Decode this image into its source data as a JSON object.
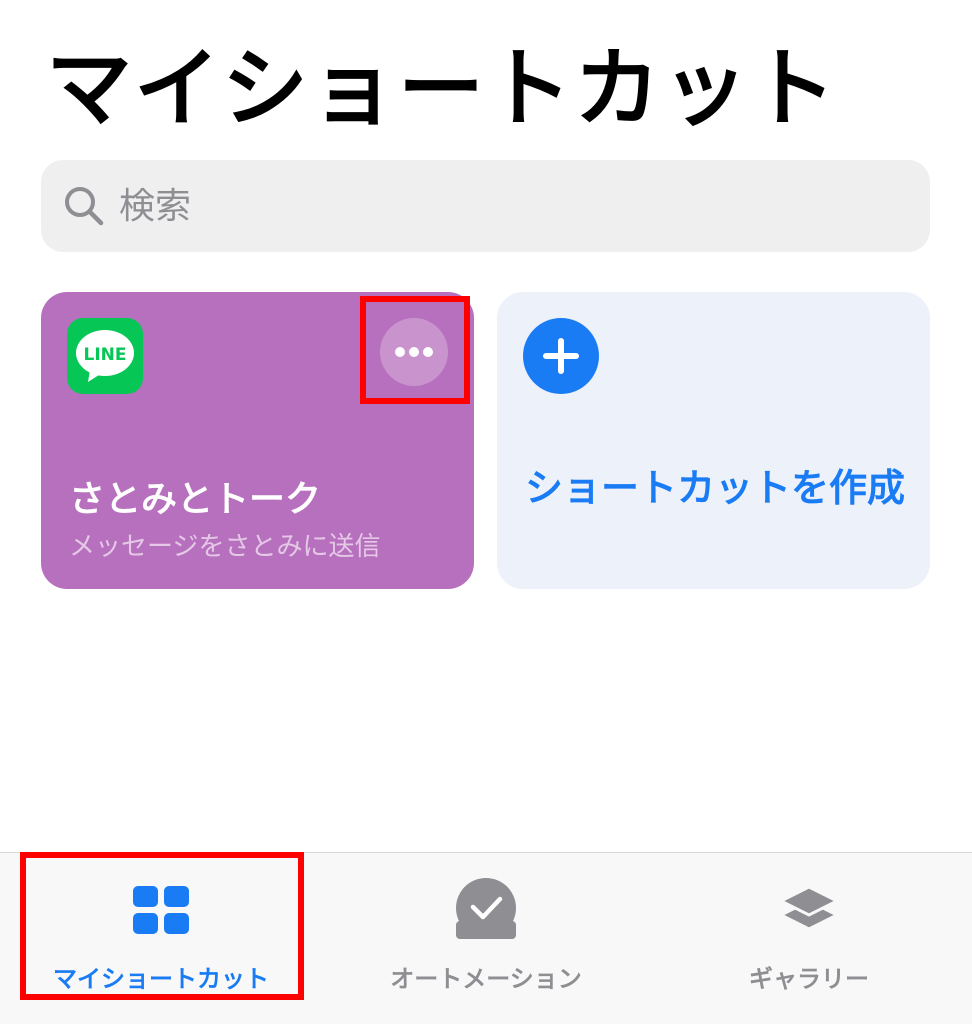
{
  "header": {
    "title": "マイショートカット"
  },
  "search": {
    "placeholder": "検索"
  },
  "shortcuts": [
    {
      "title": "さとみとトーク",
      "subtitle": "メッセージをさとみに送信",
      "app_icon_text": "LINE",
      "color": "#b770bd"
    }
  ],
  "create_card": {
    "label": "ショートカットを作成",
    "color": "#edf1fa",
    "accent": "#1a7cf4"
  },
  "tabs": [
    {
      "label": "マイショートカット",
      "icon": "grid-icon",
      "active": true
    },
    {
      "label": "オートメーション",
      "icon": "checkmark-circle-icon",
      "active": false
    },
    {
      "label": "ギャラリー",
      "icon": "layers-icon",
      "active": false
    }
  ],
  "colors": {
    "accent": "#1a7cf4",
    "highlight": "#ff0000",
    "inactive": "#8e8e93"
  }
}
